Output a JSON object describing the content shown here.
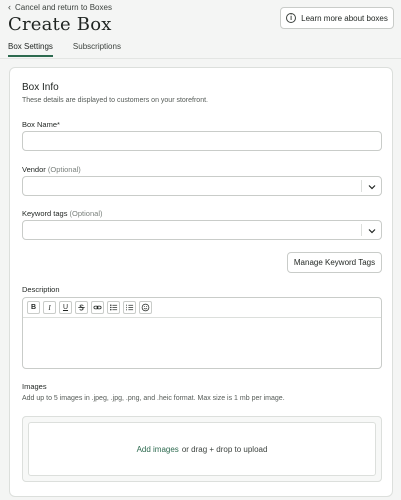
{
  "header": {
    "back_label": "Cancel and return to Boxes",
    "title": "Create Box",
    "learn_more_label": "Learn more about boxes"
  },
  "tabs": [
    {
      "label": "Box Settings",
      "active": true
    },
    {
      "label": "Subscriptions",
      "active": false
    }
  ],
  "box_info": {
    "title": "Box Info",
    "subtitle": "These details are displayed to customers on your storefront."
  },
  "fields": {
    "box_name": {
      "label": "Box Name*",
      "value": ""
    },
    "vendor": {
      "label": "Vendor",
      "optional": "(Optional)",
      "value": ""
    },
    "keyword_tags": {
      "label": "Keyword tags",
      "optional": "(Optional)",
      "value": ""
    }
  },
  "manage_tags_label": "Manage Keyword Tags",
  "description": {
    "label": "Description",
    "toolbar": {
      "bold": "B",
      "italic": "I",
      "underline": "U"
    }
  },
  "images": {
    "label": "Images",
    "help": "Add up to 5 images in .jpeg, .jpg, .png, and .heic format. Max size is 1 mb per image.",
    "add_link": "Add images",
    "drop_text": "or drag + drop to upload"
  },
  "colors": {
    "accent": "#2d6a4f",
    "background": "#f4f5f4",
    "border": "#c9ccc9"
  }
}
